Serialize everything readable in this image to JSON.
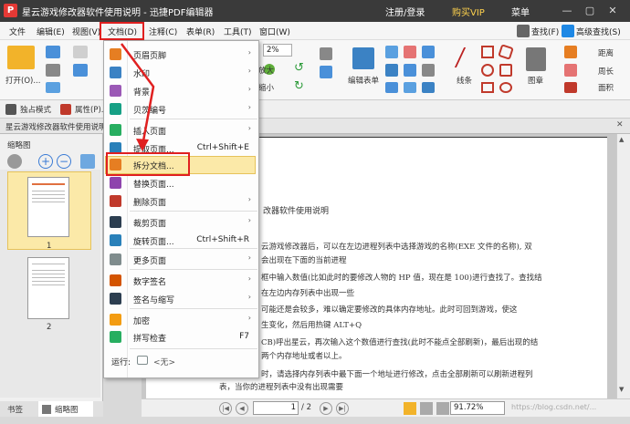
{
  "title_bar": {
    "title": "星云游戏修改器软件使用说明 - 迅捷PDF编辑器",
    "login": "注册/登录",
    "vip": "购买VIP",
    "menu": "菜单"
  },
  "menubar": {
    "items": [
      "文件",
      "编辑(E)",
      "视图(V)",
      "文档(D)",
      "注释(C)",
      "表单(R)",
      "工具(T)",
      "窗口(W)"
    ],
    "find": "查找(F)",
    "advanced_find": "高级查找(S)"
  },
  "toolbar": {
    "open": "打开(O)...",
    "zoom": "2%",
    "zoom_in": "放大",
    "zoom_out": "缩小",
    "edit_form": "编辑表单",
    "line": "线条",
    "stamp": "图章",
    "distance": "距离",
    "perimeter": "周长",
    "area": "面积"
  },
  "toolbar2": {
    "exclusive": "独占模式",
    "properties": "属性(P)..."
  },
  "doc_tab": {
    "name": "星云游戏修改器软件使用说明"
  },
  "left_panel": {
    "header": "缩略图",
    "thumbs": [
      "1",
      "2"
    ],
    "tabs": [
      "书签",
      "缩略图"
    ]
  },
  "document": {
    "heading": "改器软件使用说明",
    "lines": [
      "云游戏修改器后，可以在左边进程列表中选择游戏的名称(EXE 文件的名称), 双",
      "会出现在下面的当前进程",
      "框中输入数值(比如此时的要修改人物的 HP 值，现在是 100)进行查找了。查找结",
      "在左边内存列表中出现一些",
      "可能还是会较多，难以确定要修改的具体内存地址。此时可回到游戏，使这",
      "生变化，然后用热键 ALT+Q",
      "CB)呼出星云，再次输入这个数值进行查找(此时不能点全部刷新)，最后出现的结",
      "两个内存地址或者以上。",
      "时，请选择内存列表中最下面一个地址进行修改，点击全部刷新可以刷新进程列",
      "表，当你的进程列表中没有出现需要"
    ]
  },
  "status": {
    "page": "1",
    "page_total": "/ 2",
    "zoom": "91.72%",
    "watermark": "https://blog.csdn.net/..."
  },
  "dropdown": {
    "items": [
      {
        "label": "页眉页脚",
        "shortcut": "",
        "arrow": "›",
        "color": "#e67e22"
      },
      {
        "label": "水印",
        "shortcut": "",
        "arrow": "›",
        "color": "#3b82c4"
      },
      {
        "label": "背景",
        "shortcut": "",
        "arrow": "›",
        "color": "#9b59b6"
      },
      {
        "label": "贝茨编号",
        "shortcut": "",
        "arrow": "›",
        "color": "#16a085"
      },
      {
        "label": "插入页面",
        "shortcut": "",
        "arrow": "›",
        "color": "#27ae60"
      },
      {
        "label": "提取页面...",
        "shortcut": "Ctrl+Shift+E",
        "arrow": "",
        "color": "#2980b9"
      },
      {
        "label": "拆分文档...",
        "shortcut": "",
        "arrow": "",
        "color": "#e67e22"
      },
      {
        "label": "替换页面...",
        "shortcut": "",
        "arrow": "",
        "color": "#8e44ad"
      },
      {
        "label": "删除页面",
        "shortcut": "",
        "arrow": "›",
        "color": "#c0392b"
      },
      {
        "label": "裁剪页面",
        "shortcut": "",
        "arrow": "›",
        "color": "#2c3e50"
      },
      {
        "label": "旋转页面...",
        "shortcut": "Ctrl+Shift+R",
        "arrow": "",
        "color": "#2980b9"
      },
      {
        "label": "更多页面",
        "shortcut": "",
        "arrow": "›",
        "color": "#7f8c8d"
      },
      {
        "label": "数字签名",
        "shortcut": "",
        "arrow": "›",
        "color": "#d35400"
      },
      {
        "label": "签名与缩写",
        "shortcut": "",
        "arrow": "›",
        "color": "#2c3e50"
      },
      {
        "label": "加密",
        "shortcut": "",
        "arrow": "›",
        "color": "#f39c12"
      },
      {
        "label": "拼写检查",
        "shortcut": "F7",
        "arrow": "",
        "color": "#27ae60"
      },
      {
        "label": "运行:",
        "shortcut": "",
        "arrow": "",
        "color": "#7f8c8d"
      }
    ],
    "run_value": "<无>"
  }
}
